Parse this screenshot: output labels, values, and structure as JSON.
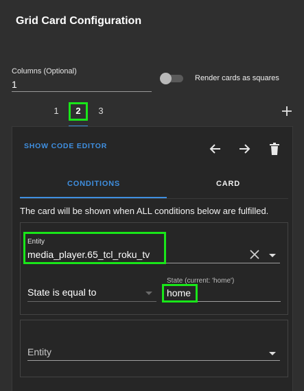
{
  "dialog": {
    "title": "Grid Card Configuration"
  },
  "columns": {
    "label": "Columns (Optional)",
    "value": "1"
  },
  "render_squares": {
    "label": "Render cards as squares",
    "enabled": false
  },
  "card_tabs": {
    "items": [
      "1",
      "2",
      "3"
    ],
    "active": "2"
  },
  "editor": {
    "show_code_label": "SHOW CODE EDITOR"
  },
  "subtabs": {
    "conditions": "CONDITIONS",
    "card": "CARD",
    "active": "conditions"
  },
  "info_text": "The card will be shown when ALL conditions below are fulfilled.",
  "condition1": {
    "entity_label": "Entity",
    "entity_value": "media_player.65_tcl_roku_tv",
    "state_select_value": "State is equal to",
    "state_label": "State (current: 'home')",
    "state_value": "home"
  },
  "condition2": {
    "entity_label": "Entity"
  },
  "colors": {
    "accent": "#3f8fe0",
    "highlight": "#19e619",
    "background": "#2f2f2f"
  },
  "icons": [
    "plus-icon",
    "arrow-left-icon",
    "arrow-right-icon",
    "trash-icon",
    "close-icon",
    "chevron-down-icon"
  ]
}
